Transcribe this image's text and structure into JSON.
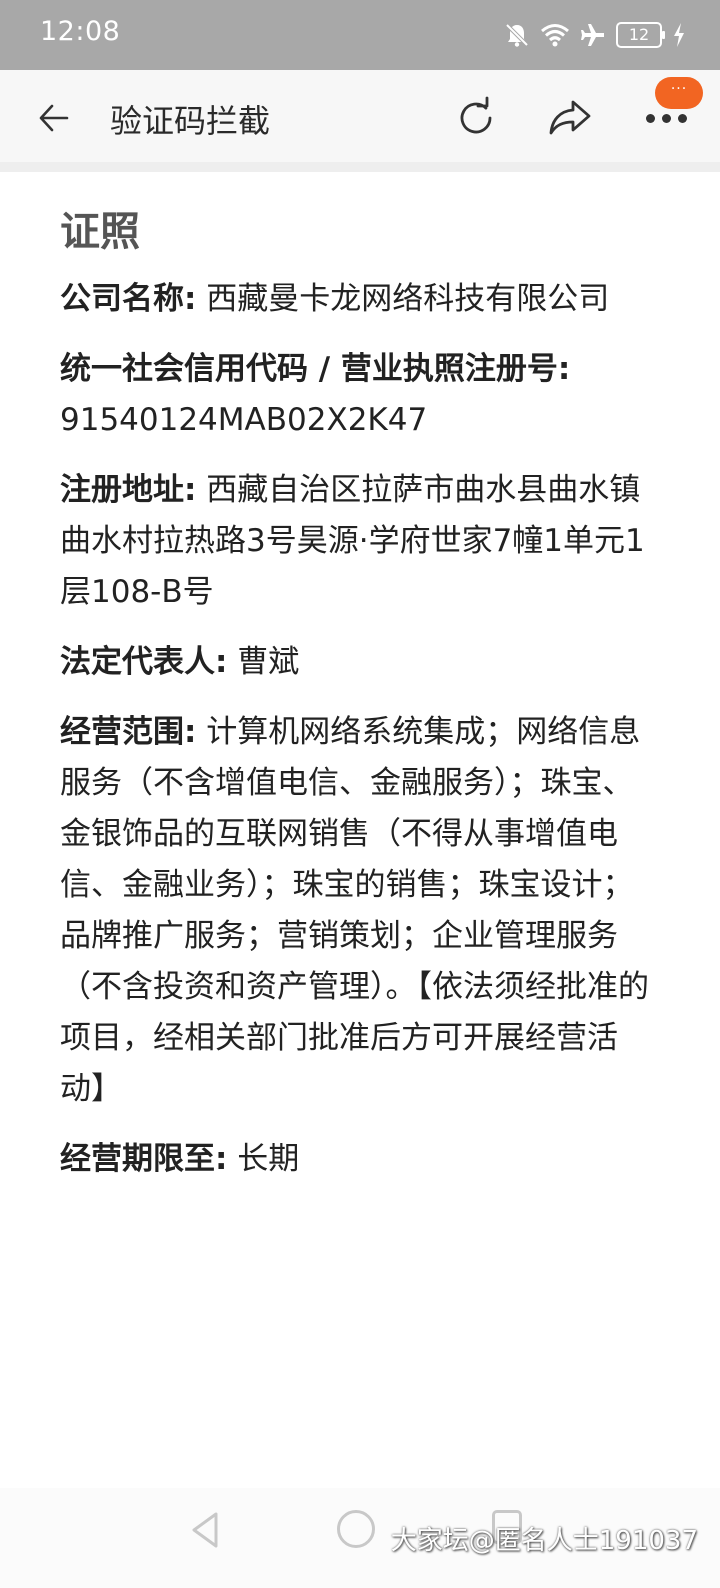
{
  "status_bar": {
    "time": "12:08",
    "battery": "12",
    "icons": [
      "mute-bell-icon",
      "wifi-icon",
      "airplane-icon",
      "battery-icon",
      "charging-icon"
    ]
  },
  "app_bar": {
    "title": "验证码拦截",
    "badge": "···",
    "accent_color": "#f26522"
  },
  "license": {
    "section_title": "证照",
    "fields": [
      {
        "label": "公司名称:",
        "value": "西藏曼卡龙网络科技有限公司"
      },
      {
        "label": "统一社会信用代码 / 营业执照注册号:",
        "value": "91540124MAB02X2K47"
      },
      {
        "label": "注册地址:",
        "value": "西藏自治区拉萨市曲水县曲水镇曲水村拉热路3号昊源·学府世家7幢1单元1层108-B号"
      },
      {
        "label": "法定代表人:",
        "value": "曹斌"
      },
      {
        "label": "经营范围:",
        "value": "计算机网络系统集成；网络信息服务（不含增值电信、金融服务）；珠宝、金银饰品的互联网销售（不得从事增值电信、金融业务）；珠宝的销售；珠宝设计；品牌推广服务；营销策划；企业管理服务（不含投资和资产管理）。【依法须经批准的项目，经相关部门批准后方可开展经营活动】"
      },
      {
        "label": "经营期限至:",
        "value": "长期"
      }
    ]
  },
  "watermark": "大家坛@匿名人士191037"
}
